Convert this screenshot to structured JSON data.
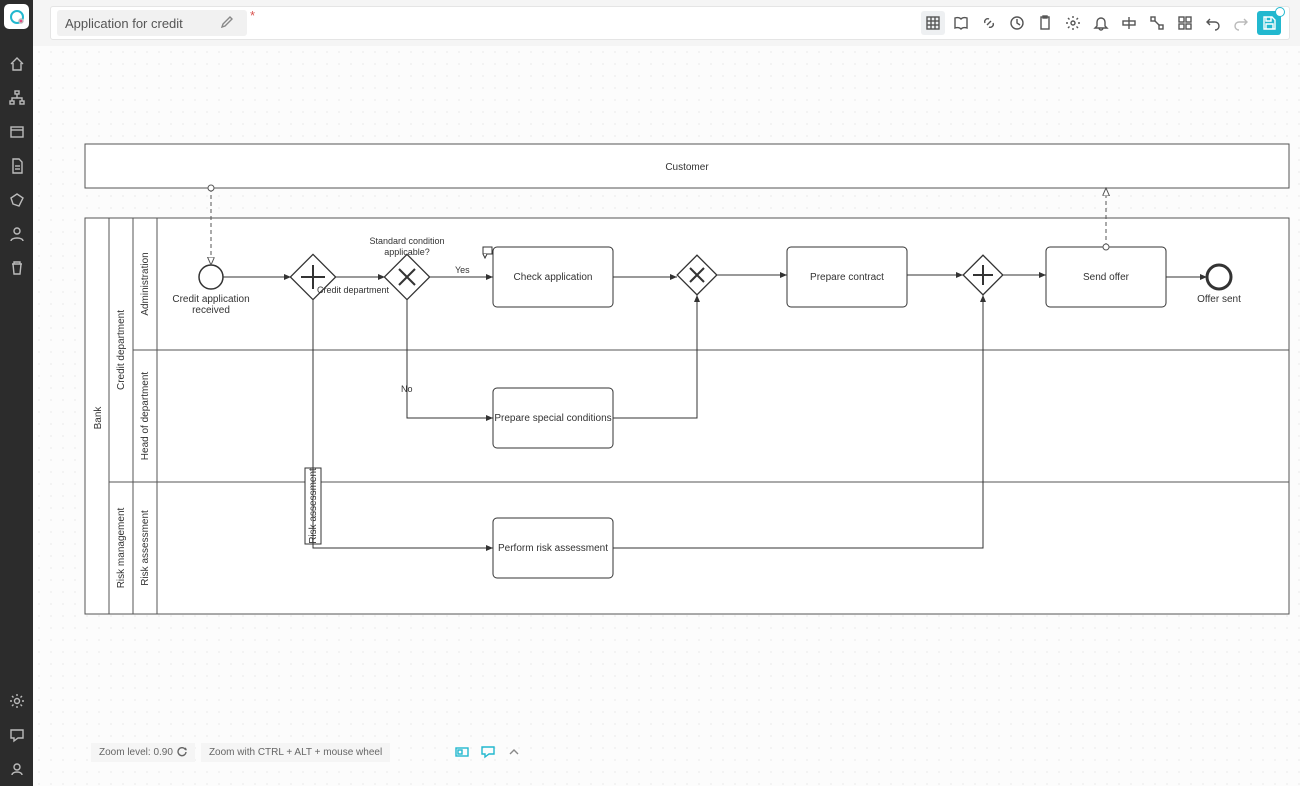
{
  "header": {
    "title": "Application for credit",
    "dirty_marker": "*"
  },
  "pools": {
    "customer": {
      "name": "Customer"
    },
    "bank": {
      "name": "Bank",
      "lanes": [
        {
          "id": "credit",
          "name": "Credit department",
          "sublanes": [
            {
              "id": "admin",
              "name": "Administration"
            },
            {
              "id": "head",
              "name": "Head of department"
            }
          ]
        },
        {
          "id": "risk",
          "name": "Risk management",
          "sublanes": [
            {
              "id": "riskassess",
              "name": "Risk assessment"
            }
          ]
        }
      ]
    }
  },
  "elements": {
    "start": {
      "label_l1": "Credit application",
      "label_l2": "received"
    },
    "gw1": {
      "label": "Credit department"
    },
    "gw2": {
      "label_l1": "Standard condition",
      "label_l2": "applicable?"
    },
    "edge_yes": "Yes",
    "edge_no": "No",
    "task_check": "Check application",
    "task_special": "Prepare special conditions",
    "task_risk": "Perform risk assessment",
    "subproc_risk": "Risk assessment",
    "task_contract": "Prepare contract",
    "task_send": "Send offer",
    "end": "Offer sent"
  },
  "status": {
    "zoom_label": "Zoom level: 0.90",
    "zoom_hint": "Zoom with CTRL + ALT + mouse wheel"
  }
}
